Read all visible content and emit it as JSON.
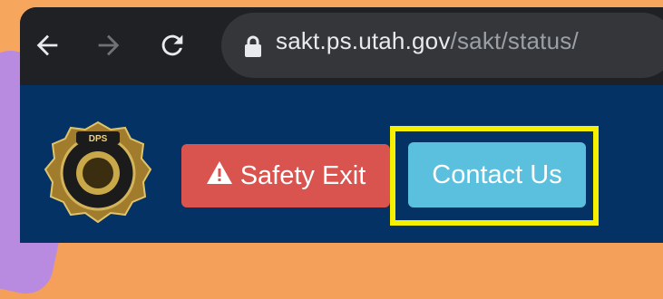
{
  "browser": {
    "url_domain": "sakt.ps.utah.gov",
    "url_path": "/sakt/status/",
    "icons": [
      "back-arrow-icon",
      "forward-arrow-icon",
      "reload-icon",
      "lock-icon"
    ]
  },
  "header": {
    "logo_icon": "utah-dps-badge-icon",
    "logo_text": "DPS UTAH DEPARTMENT OF PUBLIC SAFETY",
    "safety_exit_label": "Safety Exit",
    "safety_exit_icon": "warning-triangle-icon",
    "contact_label": "Contact Us"
  },
  "colors": {
    "header_bg": "#053265",
    "safety_exit": "#d9534f",
    "contact": "#5bc0de",
    "highlight": "#f6ef00"
  }
}
